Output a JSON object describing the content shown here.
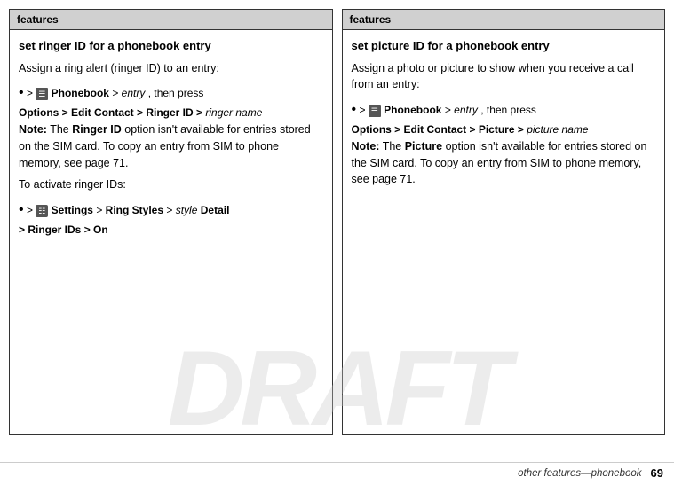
{
  "page": {
    "watermark": "DRAFT",
    "footer": {
      "label": "other features—phonebook",
      "page_number": "69"
    }
  },
  "left_box": {
    "header": "features",
    "title": "set ringer ID for a phonebook entry",
    "paragraph1": "Assign a ring alert (ringer ID) to an entry:",
    "nav1_bullet": "s",
    "nav1_text1": " > ",
    "nav1_icon": "M",
    "nav1_phonebook": "Phonebook",
    "nav1_text2": " > ",
    "nav1_italic": "entry",
    "nav1_text3": ", then press",
    "nav1_line2": "Options > Edit Contact > Ringer ID > ",
    "nav1_italic2": "ringer name",
    "note_label": "Note:",
    "note_text": " The ",
    "note_bold": "Ringer ID",
    "note_text2": " option isn't available for entries stored on the SIM card. To copy an entry from SIM to phone memory, see page 71.",
    "para2": "To activate ringer IDs:",
    "nav2_bullet": "s",
    "nav2_text1": " > ",
    "nav2_icon": "Q",
    "nav2_settings": "Settings",
    "nav2_text2": " > ",
    "nav2_ringstyles": "Ring Styles",
    "nav2_text3": " > ",
    "nav2_italic": "style",
    "nav2_text4": " Detail",
    "nav2_line2": "> Ringer IDs > ",
    "nav2_on": "On"
  },
  "right_box": {
    "header": "features",
    "title": "set picture ID for a phonebook entry",
    "paragraph1": "Assign a photo or picture to show when you receive a call from an entry:",
    "nav1_bullet": "s",
    "nav1_icon": "M",
    "nav1_phonebook": "Phonebook",
    "nav1_italic": "entry",
    "nav1_text3": ", then press",
    "nav1_line2": "Options > Edit Contact > Picture > ",
    "nav1_italic2": "picture name",
    "note_label": "Note:",
    "note_bold": "Picture",
    "note_text2": " option isn't available for entries stored on the SIM card. To copy an entry from SIM to phone memory, see page 71."
  }
}
